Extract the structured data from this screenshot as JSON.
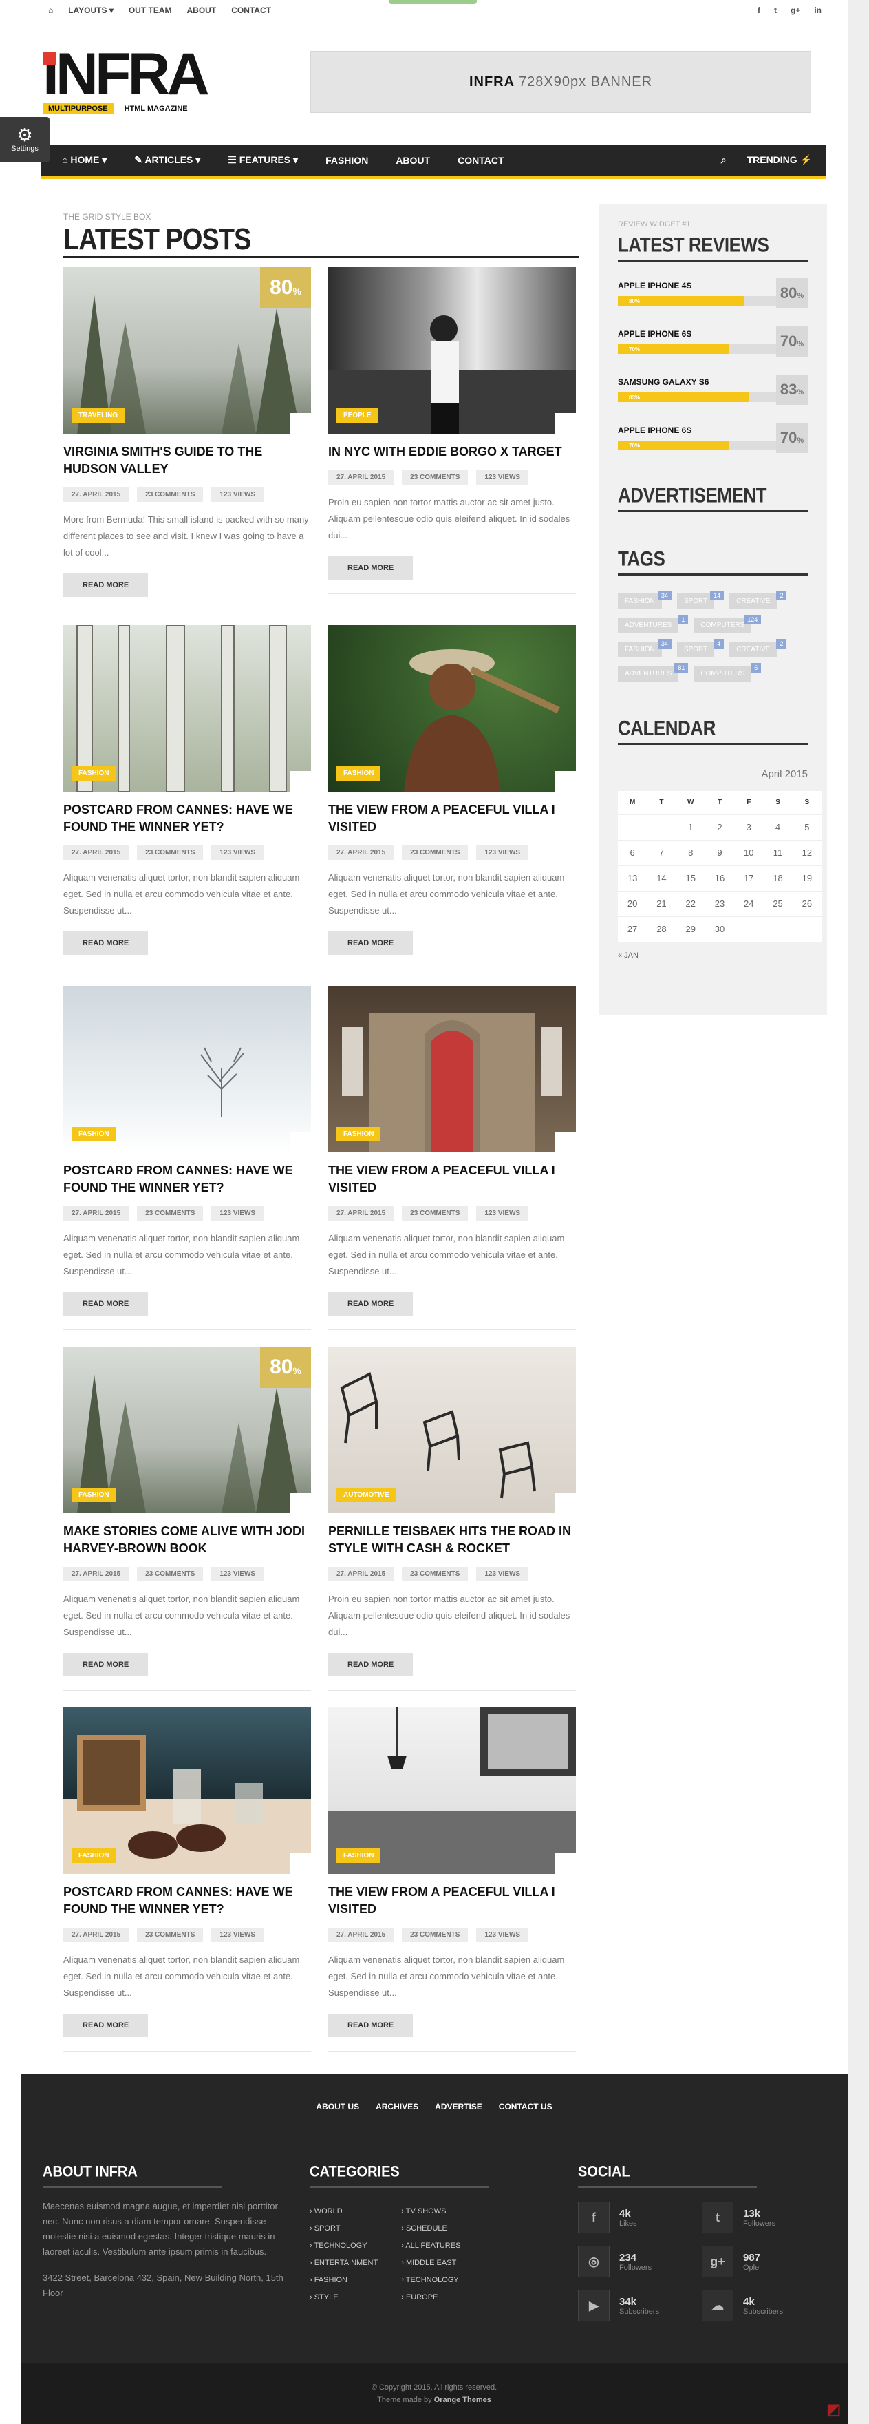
{
  "topbar": {
    "links": [
      "LAYOUTS ▾",
      "OUT TEAM",
      "ABOUT",
      "CONTACT"
    ],
    "social_icons": [
      "facebook-icon",
      "twitter-icon",
      "google-plus-icon",
      "linkedin-icon"
    ],
    "social_glyphs": [
      "f",
      "t",
      "g+",
      "in"
    ]
  },
  "logo": {
    "text": "INFRA",
    "tag1": "MULTIPURPOSE",
    "tag2": "HTML MAGAZINE"
  },
  "banner": {
    "brand": "INFRA",
    "text": "728X90px BANNER"
  },
  "settings": {
    "label": "Settings"
  },
  "mainnav": {
    "items": [
      "⌂ HOME ▾",
      "✎ ARTICLES ▾",
      "☰ FEATURES ▾",
      "FASHION",
      "ABOUT",
      "CONTACT"
    ],
    "trending": "TRENDING ⚡"
  },
  "section": {
    "label": "THE GRID STYLE BOX",
    "title": "LATEST POSTS"
  },
  "posts": [
    {
      "category": "TRAVELING",
      "title": "VIRGINIA SMITH'S GUIDE TO THE HUDSON VALLEY",
      "date": "27. APRIL 2015",
      "comments": "23 COMMENTS",
      "views": "123 VIEWS",
      "excerpt": "More from Bermuda! This small island is packed with so many different places to see and visit. I knew I was going to have a lot of cool...",
      "readmore": "READ MORE",
      "score": "80",
      "scene": "forest"
    },
    {
      "category": "PEOPLE",
      "title": "IN NYC WITH EDDIE BORGO X TARGET",
      "date": "27. APRIL 2015",
      "comments": "23 COMMENTS",
      "views": "123 VIEWS",
      "excerpt": "Proin eu sapien non tortor mattis auctor ac sit amet justo. Aliquam pellentesque odio quis eleifend aliquet. In id sodales dui...",
      "readmore": "READ MORE",
      "score": "",
      "scene": "subway"
    },
    {
      "category": "FASHION",
      "title": "POSTCARD FROM CANNES: HAVE WE FOUND THE WINNER YET?",
      "date": "27. APRIL 2015",
      "comments": "23 COMMENTS",
      "views": "123 VIEWS",
      "excerpt": "Aliquam venenatis aliquet tortor, non blandit sapien aliquam eget. Sed in nulla et arcu commodo vehicula vitae et ante. Suspendisse ut...",
      "readmore": "READ MORE",
      "score": "",
      "scene": "trees"
    },
    {
      "category": "FASHION",
      "title": "THE VIEW FROM A PEACEFUL VILLA I VISITED",
      "date": "27. APRIL 2015",
      "comments": "23 COMMENTS",
      "views": "123 VIEWS",
      "excerpt": "Aliquam venenatis aliquet tortor, non blandit sapien aliquam eget. Sed in nulla et arcu commodo vehicula vitae et ante. Suspendisse ut...",
      "readmore": "READ MORE",
      "score": "",
      "scene": "oldman"
    },
    {
      "category": "FASHION",
      "title": "POSTCARD FROM CANNES: HAVE WE FOUND THE WINNER YET?",
      "date": "27. APRIL 2015",
      "comments": "23 COMMENTS",
      "views": "123 VIEWS",
      "excerpt": "Aliquam venenatis aliquet tortor, non blandit sapien aliquam eget. Sed in nulla et arcu commodo vehicula vitae et ante. Suspendisse ut...",
      "readmore": "READ MORE",
      "score": "",
      "scene": "snow"
    },
    {
      "category": "FASHION",
      "title": "THE VIEW FROM A PEACEFUL VILLA I VISITED",
      "date": "27. APRIL 2015",
      "comments": "23 COMMENTS",
      "views": "123 VIEWS",
      "excerpt": "Aliquam venenatis aliquet tortor, non blandit sapien aliquam eget. Sed in nulla et arcu commodo vehicula vitae et ante. Suspendisse ut...",
      "readmore": "READ MORE",
      "score": "",
      "scene": "door"
    },
    {
      "category": "FASHION",
      "title": "MAKE STORIES COME ALIVE WITH JODI HARVEY-BROWN BOOK",
      "date": "27. APRIL 2015",
      "comments": "23 COMMENTS",
      "views": "123 VIEWS",
      "excerpt": "Aliquam venenatis aliquet tortor, non blandit sapien aliquam eget. Sed in nulla et arcu commodo vehicula vitae et ante. Suspendisse ut...",
      "readmore": "READ MORE",
      "score": "80",
      "scene": "forest"
    },
    {
      "category": "AUTOMOTIVE",
      "title": "PERNILLE TEISBAEK HITS THE ROAD IN STYLE WITH CASH & ROCKET",
      "date": "27. APRIL 2015",
      "comments": "23 COMMENTS",
      "views": "123 VIEWS",
      "excerpt": "Proin eu sapien non tortor mattis auctor ac sit amet justo. Aliquam pellentesque odio quis eleifend aliquet. In id sodales dui...",
      "readmore": "READ MORE",
      "score": "",
      "scene": "chairs"
    },
    {
      "category": "FASHION",
      "title": "POSTCARD FROM CANNES: HAVE WE FOUND THE WINNER YET?",
      "date": "27. APRIL 2015",
      "comments": "23 COMMENTS",
      "views": "123 VIEWS",
      "excerpt": "Aliquam venenatis aliquet tortor, non blandit sapien aliquam eget. Sed in nulla et arcu commodo vehicula vitae et ante. Suspendisse ut...",
      "readmore": "READ MORE",
      "score": "",
      "scene": "cupcakes"
    },
    {
      "category": "FASHION",
      "title": "THE VIEW FROM A PEACEFUL VILLA I VISITED",
      "date": "27. APRIL 2015",
      "comments": "23 COMMENTS",
      "views": "123 VIEWS",
      "excerpt": "Aliquam venenatis aliquet tortor, non blandit sapien aliquam eget. Sed in nulla et arcu commodo vehicula vitae et ante. Suspendisse ut...",
      "readmore": "READ MORE",
      "score": "",
      "scene": "kitchen"
    }
  ],
  "sidebar": {
    "review_label": "REVIEW WIDGET #1",
    "review_title": "LATEST REVIEWS",
    "reviews": [
      {
        "name": "APPLE IPHONE 4S",
        "level": 0.8,
        "bar_label": "80%",
        "score": "80"
      },
      {
        "name": "APPLE IPHONE 6S",
        "level": 0.7,
        "bar_label": "70%",
        "score": "70"
      },
      {
        "name": "SAMSUNG GALAXY S6",
        "level": 0.83,
        "bar_label": "83%",
        "score": "83"
      },
      {
        "name": "APPLE IPHONE 6S",
        "level": 0.7,
        "bar_label": "70%",
        "score": "70"
      }
    ],
    "ad_title": "ADVERTISEMENT",
    "tags_title": "TAGS",
    "tags": [
      {
        "name": "FASHION",
        "count": "34"
      },
      {
        "name": "SPORT",
        "count": "14"
      },
      {
        "name": "CREATIVE",
        "count": "2"
      },
      {
        "name": "ADVENTURES",
        "count": "1"
      },
      {
        "name": "COMPUTERS",
        "count": "124"
      },
      {
        "name": "FASHION",
        "count": "34"
      },
      {
        "name": "SPORT",
        "count": "4"
      },
      {
        "name": "CREATIVE",
        "count": "2"
      },
      {
        "name": "ADVENTURES",
        "count": "81"
      },
      {
        "name": "COMPUTERS",
        "count": "5"
      }
    ],
    "calendar_title": "CALENDAR",
    "calendar_month": "April 2015",
    "calendar_days": [
      "M",
      "T",
      "W",
      "T",
      "F",
      "S",
      "S"
    ],
    "calendar_rows": [
      [
        "",
        "",
        "1",
        "2",
        "3",
        "4",
        "5"
      ],
      [
        "6",
        "7",
        "8",
        "9",
        "10",
        "11",
        "12"
      ],
      [
        "13",
        "14",
        "15",
        "16",
        "17",
        "18",
        "19"
      ],
      [
        "20",
        "21",
        "22",
        "23",
        "24",
        "25",
        "26"
      ],
      [
        "27",
        "28",
        "29",
        "30",
        "",
        "",
        ""
      ]
    ],
    "calendar_prev": "« JAN"
  },
  "footer": {
    "links": [
      "ABOUT US",
      "ARCHIVES",
      "ADVERTISE",
      "CONTACT US"
    ],
    "about_title": "ABOUT INFRA",
    "about_text": "Maecenas euismod magna augue, et imperdiet nisi porttitor nec. Nunc non risus a diam tempor ornare. Suspendisse molestie nisi a euismod egestas. Integer tristique mauris in laoreet iaculis. Vestibulum ante ipsum primis in faucibus.",
    "address": "3422 Street, Barcelona 432, Spain, New Building North, 15th Floor",
    "categories_title": "CATEGORIES",
    "categories_col1": [
      "› WORLD",
      "› SPORT",
      "› TECHNOLOGY",
      "› ENTERTAINMENT",
      "› FASHION",
      "› STYLE"
    ],
    "categories_col2": [
      "› TV SHOWS",
      "› SCHEDULE",
      "› ALL FEATURES",
      "› MIDDLE EAST",
      "› TECHNOLOGY",
      "› EUROPE"
    ],
    "social_title": "SOCIAL",
    "social": [
      {
        "icon": "facebook-icon",
        "glyph": "f",
        "count": "4k",
        "label": "Likes"
      },
      {
        "icon": "twitter-icon",
        "glyph": "t",
        "count": "13k",
        "label": "Followers"
      },
      {
        "icon": "instagram-icon",
        "glyph": "◎",
        "count": "234",
        "label": "Followers"
      },
      {
        "icon": "google-plus-icon",
        "glyph": "g+",
        "count": "987",
        "label": "Ople"
      },
      {
        "icon": "youtube-icon",
        "glyph": "▶",
        "count": "34k",
        "label": "Subscribers"
      },
      {
        "icon": "soundcloud-icon",
        "glyph": "☁",
        "count": "4k",
        "label": "Subscribers"
      }
    ]
  },
  "copyright": {
    "line1": "© Copyright 2015. All rights reserved.",
    "line2_prefix": "Theme made by",
    "line2_brand": "Orange Themes"
  },
  "colors": {
    "accent": "#f5c518",
    "nav_bg": "#262626",
    "footer_bg": "#262626",
    "score_bg": "#d8bd5a"
  }
}
